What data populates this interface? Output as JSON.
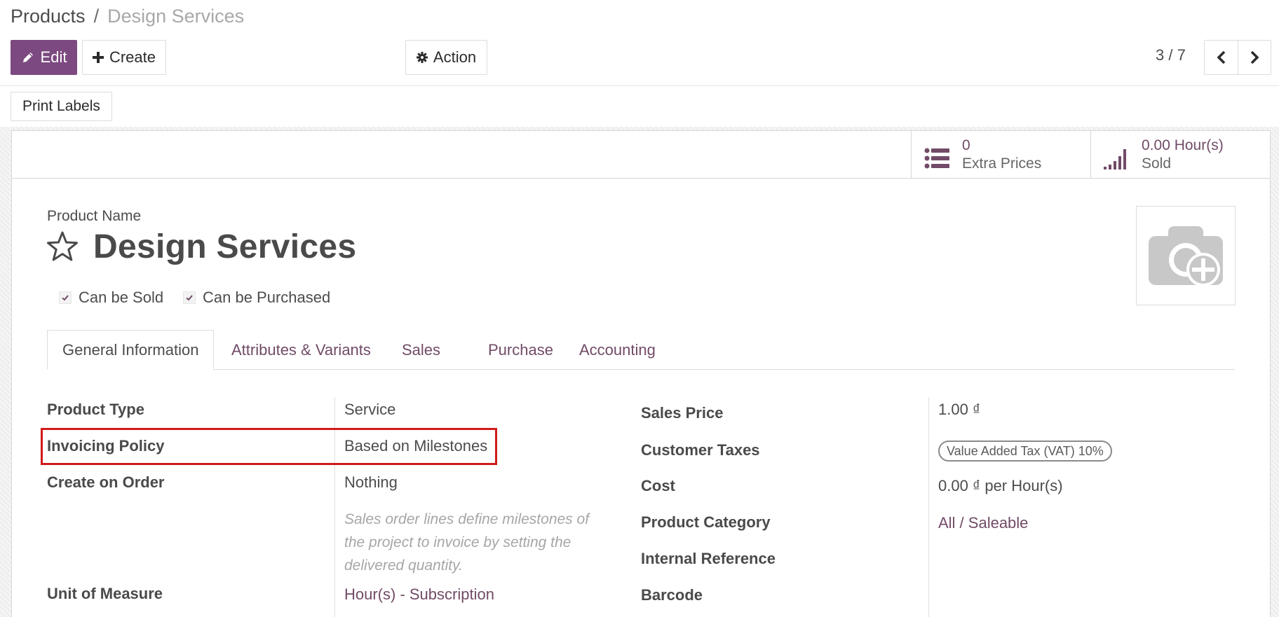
{
  "breadcrumb": {
    "parent": "Products",
    "separator": "/",
    "current": "Design Services"
  },
  "toolbar": {
    "edit_label": "Edit",
    "create_label": "Create",
    "action_label": "Action",
    "print_labels_label": "Print Labels"
  },
  "pager": {
    "value": "3 / 7"
  },
  "smart_buttons": {
    "extra_prices": {
      "value": "0",
      "label": "Extra Prices",
      "icon": "list-icon"
    },
    "sold": {
      "value": "0.00 Hour(s)",
      "label": "Sold",
      "icon": "signal-icon"
    }
  },
  "product": {
    "name_label": "Product Name",
    "name": "Design Services",
    "can_be_sold": {
      "label": "Can be Sold",
      "checked": true
    },
    "can_be_purchased": {
      "label": "Can be Purchased",
      "checked": true
    }
  },
  "tabs": [
    {
      "label": "General Information",
      "active": true
    },
    {
      "label": "Attributes & Variants",
      "active": false
    },
    {
      "label": "Sales",
      "active": false
    },
    {
      "label": "Purchase",
      "active": false
    },
    {
      "label": "Accounting",
      "active": false
    }
  ],
  "left_fields": {
    "product_type": {
      "label": "Product Type",
      "value": "Service"
    },
    "invoicing_policy": {
      "label": "Invoicing Policy",
      "value": "Based on Milestones"
    },
    "create_on_order": {
      "label": "Create on Order",
      "value": "Nothing"
    },
    "help_text": "Sales order lines define milestones of the project to invoice by setting the delivered quantity.",
    "unit_of_measure": {
      "label": "Unit of Measure",
      "value": "Hour(s) - Subscription"
    }
  },
  "right_fields": {
    "sales_price": {
      "label": "Sales Price",
      "value": "1.00 ₫"
    },
    "customer_taxes": {
      "label": "Customer Taxes",
      "value": "Value Added Tax (VAT) 10%"
    },
    "cost": {
      "label": "Cost",
      "value": "0.00 ₫ per Hour(s)"
    },
    "product_category": {
      "label": "Product Category",
      "value": "All / Saleable"
    },
    "internal_reference": {
      "label": "Internal Reference",
      "value": ""
    },
    "barcode": {
      "label": "Barcode",
      "value": ""
    }
  },
  "colors": {
    "primary": "#7c4a80",
    "link": "#714b67",
    "highlight": "#d11a1a"
  }
}
